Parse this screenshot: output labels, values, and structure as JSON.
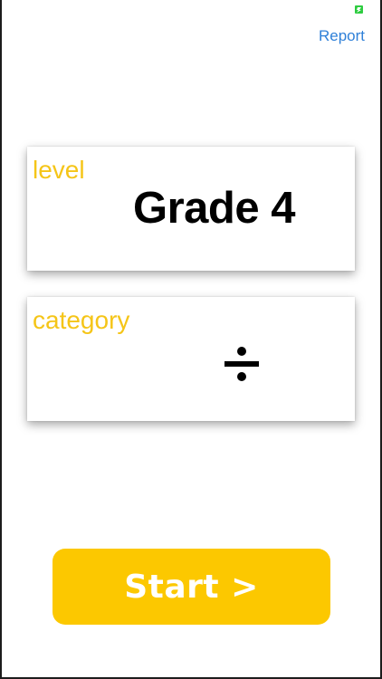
{
  "status": {
    "indicator_icon": "battery-icon",
    "indicator_color": "#2ecc40"
  },
  "header": {
    "report_label": "Report",
    "report_color": "#2f80d8"
  },
  "level_card": {
    "label": "level",
    "value": "Grade 4"
  },
  "category_card": {
    "label": "category",
    "value_icon": "divide-icon"
  },
  "start": {
    "label": "Start >",
    "color": "#fcc800"
  },
  "accent_color": "#f5c518"
}
